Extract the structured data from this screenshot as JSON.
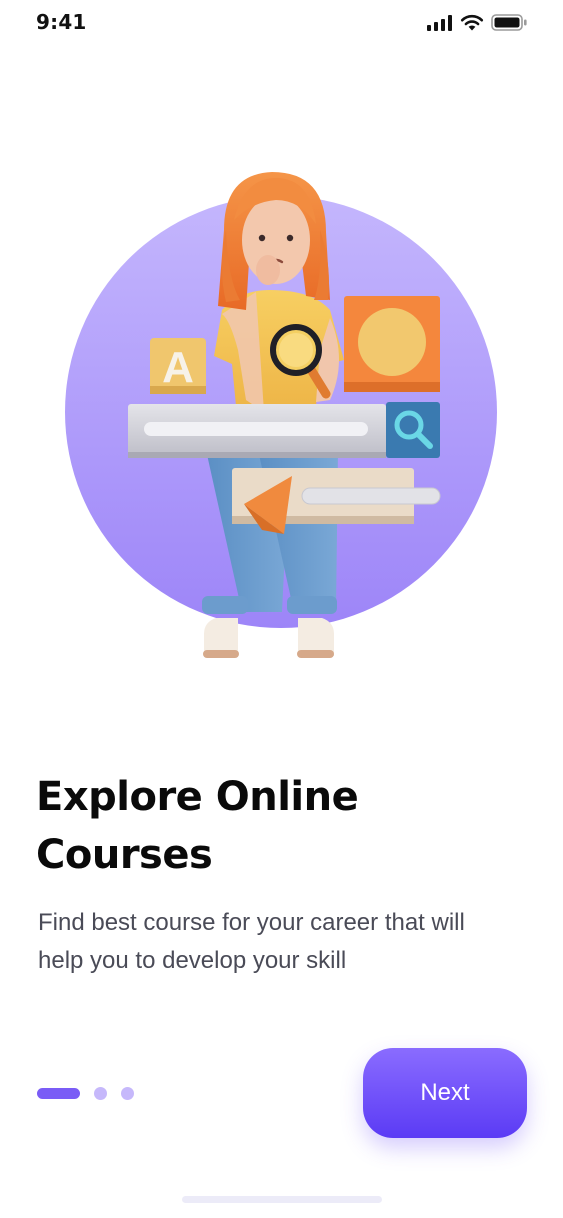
{
  "status_bar": {
    "time": "9:41",
    "icons": [
      "signal-icon",
      "wifi-icon",
      "battery-icon"
    ]
  },
  "illustration": {
    "description_icons": [
      "girl-illustration",
      "magnifier-icon",
      "search-icon",
      "letter-tile",
      "play-icon"
    ],
    "tile_letter": "A"
  },
  "onboarding": {
    "title_line1": "Explore Online",
    "title_line2": "Courses",
    "description_line1": "Find best course for your career that will",
    "description_line2": "help you to develop your skill"
  },
  "pager": {
    "total_pages": 3,
    "current_page": 1
  },
  "actions": {
    "next_label": "Next"
  },
  "colors": {
    "accent": "#6b4df7",
    "accent_light": "#c6b8fb",
    "circle": "#b3a0fb",
    "text_primary": "#0a0a0a",
    "text_secondary": "#4a4b57"
  }
}
